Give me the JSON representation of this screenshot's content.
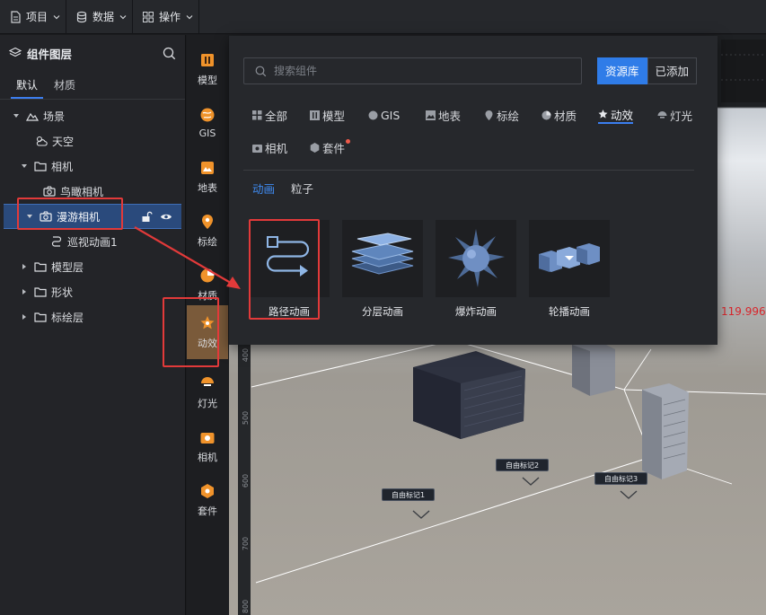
{
  "menubar": {
    "items": [
      {
        "label": "项目",
        "icon": "file-icon"
      },
      {
        "label": "数据",
        "icon": "database-icon"
      },
      {
        "label": "操作",
        "icon": "grid-icon"
      }
    ]
  },
  "layers": {
    "title": "组件图层",
    "tabs": [
      "默认",
      "材质"
    ],
    "tree": [
      {
        "label": "场景",
        "icon": "scene-icon"
      },
      {
        "label": "天空",
        "icon": "sky-icon"
      },
      {
        "label": "相机",
        "icon": "folder-icon"
      },
      {
        "label": "鸟瞰相机",
        "icon": "camera-icon"
      },
      {
        "label": "漫游相机",
        "icon": "camera-icon"
      },
      {
        "label": "巡视动画1",
        "icon": "path-icon"
      },
      {
        "label": "模型层",
        "icon": "folder-icon"
      },
      {
        "label": "形状",
        "icon": "folder-icon"
      },
      {
        "label": "标绘层",
        "icon": "folder-icon"
      }
    ]
  },
  "rail": {
    "items": [
      "模型",
      "GIS",
      "地表",
      "标绘",
      "材质",
      "动效",
      "灯光",
      "相机",
      "套件"
    ],
    "active": "动效"
  },
  "popup": {
    "search_placeholder": "搜索组件",
    "source_tabs": [
      "资源库",
      "已添加"
    ],
    "categories": [
      "全部",
      "模型",
      "GIS",
      "地表",
      "标绘",
      "材质",
      "动效",
      "灯光",
      "相机",
      "套件"
    ],
    "active_category": "动效",
    "subtabs": [
      "动画",
      "粒子"
    ],
    "active_subtab": "动画",
    "cards": [
      "路径动画",
      "分层动画",
      "爆炸动画",
      "轮播动画"
    ]
  },
  "viewport": {
    "ruler_ticks": [
      "400",
      "500",
      "600",
      "700",
      "800"
    ],
    "markers": [
      "自由标记1",
      "自由标记2",
      "自由标记3"
    ],
    "readout": "119.996"
  },
  "colors": {
    "accent": "#2f7ce8",
    "annotation": "#e23a3a",
    "rail_active": "#7a5a3a"
  }
}
